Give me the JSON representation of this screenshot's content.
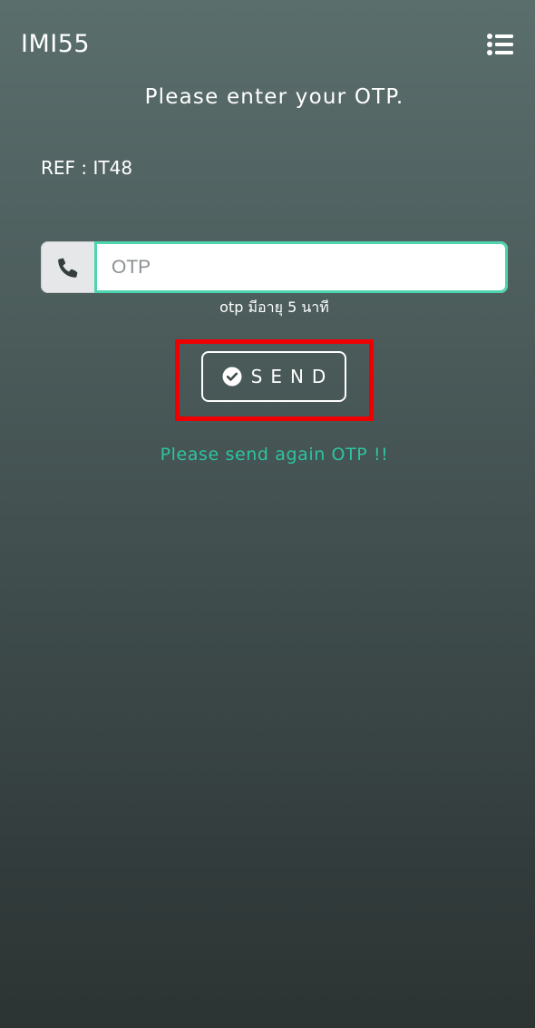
{
  "header": {
    "title": "IMI55",
    "menu_icon": "list-menu-icon"
  },
  "main": {
    "heading": "Please enter your OTP.",
    "ref_text": "REF : IT48",
    "otp_field": {
      "icon": "phone-icon",
      "placeholder": "OTP",
      "value": ""
    },
    "otp_hint": "otp มีอายุ 5 นาที",
    "send_button": {
      "icon": "check-circle-icon",
      "label": "SEND"
    },
    "resend_link": "Please send again OTP !!"
  },
  "colors": {
    "accent": "#4fd4b0",
    "resend_text": "#2ec4a0",
    "highlight_box": "#ee0000",
    "background_top": "#5a6e6c",
    "background_bottom": "#2c3333"
  }
}
